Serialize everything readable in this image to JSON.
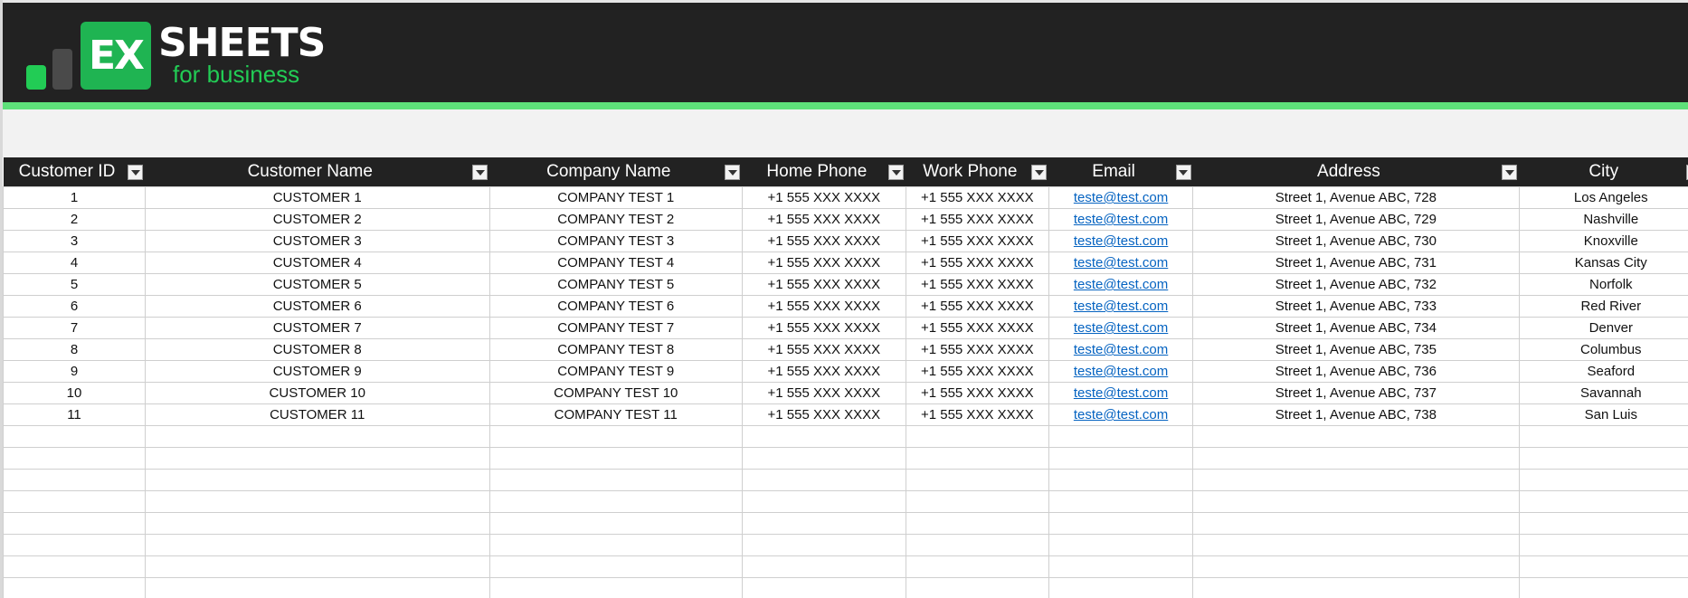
{
  "logo": {
    "mark": "EX",
    "title": "SHEETS",
    "subtitle": "for business"
  },
  "colors": {
    "header_bg": "#222222",
    "accent_green": "#5ee07a",
    "logo_green": "#1fb452",
    "link_blue": "#0563c1"
  },
  "table": {
    "columns": [
      "Customer ID",
      "Customer Name",
      "Company Name",
      "Home Phone",
      "Work Phone",
      "Email",
      "Address",
      "City"
    ],
    "rows": [
      [
        "1",
        "CUSTOMER 1",
        "COMPANY TEST 1",
        "+1 555 XXX XXXX",
        "+1 555 XXX XXXX",
        "teste@test.com",
        "Street 1, Avenue ABC, 728",
        "Los Angeles"
      ],
      [
        "2",
        "CUSTOMER 2",
        "COMPANY TEST 2",
        "+1 555 XXX XXXX",
        "+1 555 XXX XXXX",
        "teste@test.com",
        "Street 1, Avenue ABC, 729",
        "Nashville"
      ],
      [
        "3",
        "CUSTOMER 3",
        "COMPANY TEST 3",
        "+1 555 XXX XXXX",
        "+1 555 XXX XXXX",
        "teste@test.com",
        "Street 1, Avenue ABC, 730",
        "Knoxville"
      ],
      [
        "4",
        "CUSTOMER 4",
        "COMPANY TEST 4",
        "+1 555 XXX XXXX",
        "+1 555 XXX XXXX",
        "teste@test.com",
        "Street 1, Avenue ABC, 731",
        "Kansas City"
      ],
      [
        "5",
        "CUSTOMER 5",
        "COMPANY TEST 5",
        "+1 555 XXX XXXX",
        "+1 555 XXX XXXX",
        "teste@test.com",
        "Street 1, Avenue ABC, 732",
        "Norfolk"
      ],
      [
        "6",
        "CUSTOMER 6",
        "COMPANY TEST 6",
        "+1 555 XXX XXXX",
        "+1 555 XXX XXXX",
        "teste@test.com",
        "Street 1, Avenue ABC, 733",
        "Red River"
      ],
      [
        "7",
        "CUSTOMER 7",
        "COMPANY TEST 7",
        "+1 555 XXX XXXX",
        "+1 555 XXX XXXX",
        "teste@test.com",
        "Street 1, Avenue ABC, 734",
        "Denver"
      ],
      [
        "8",
        "CUSTOMER 8",
        "COMPANY TEST 8",
        "+1 555 XXX XXXX",
        "+1 555 XXX XXXX",
        "teste@test.com",
        "Street 1, Avenue ABC, 735",
        "Columbus"
      ],
      [
        "9",
        "CUSTOMER 9",
        "COMPANY TEST 9",
        "+1 555 XXX XXXX",
        "+1 555 XXX XXXX",
        "teste@test.com",
        "Street 1, Avenue ABC, 736",
        "Seaford"
      ],
      [
        "10",
        "CUSTOMER 10",
        "COMPANY TEST 10",
        "+1 555 XXX XXXX",
        "+1 555 XXX XXXX",
        "teste@test.com",
        "Street 1, Avenue ABC, 737",
        "Savannah"
      ],
      [
        "11",
        "CUSTOMER 11",
        "COMPANY TEST 11",
        "+1 555 XXX XXXX",
        "+1 555 XXX XXXX",
        "teste@test.com",
        "Street 1, Avenue ABC, 738",
        "San Luis"
      ]
    ],
    "email_column_index": 5,
    "empty_rows": 8
  }
}
